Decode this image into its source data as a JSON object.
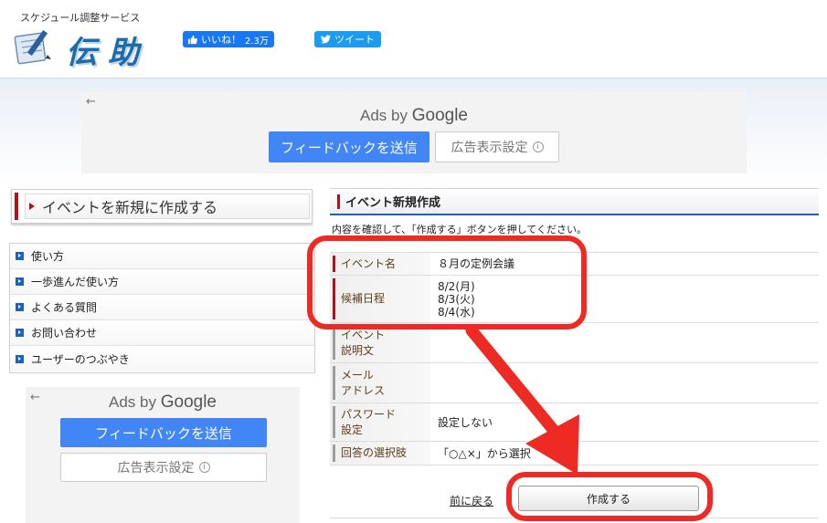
{
  "header": {
    "tagline": "スケジュール調整サービス",
    "logo_text": "伝助",
    "facebook": {
      "label": "いいね！",
      "count": "2.3万"
    },
    "twitter": {
      "label": "ツイート"
    }
  },
  "ads": {
    "back": "←",
    "ads_by": "Ads by",
    "google": "Google",
    "feedback": "フィードバックを送信",
    "settings": "広告表示設定",
    "info": "i"
  },
  "sidebar": {
    "create_event": "イベントを新規に作成する",
    "menu": [
      {
        "label": "使い方"
      },
      {
        "label": "一歩進んだ使い方"
      },
      {
        "label": "よくある質問"
      },
      {
        "label": "お問い合わせ"
      },
      {
        "label": "ユーザーのつぶやき"
      }
    ]
  },
  "main": {
    "title": "イベント新規作成",
    "instruction": "内容を確認して、「作成する」ボタンを押してください。",
    "rows": [
      {
        "label": "イベント名",
        "value": [
          "８月の定例会議"
        ]
      },
      {
        "label": "候補日程",
        "value": [
          "8/2(月)",
          "8/3(火)",
          "8/4(水)"
        ]
      },
      {
        "label": "イベント\n説明文",
        "value": []
      },
      {
        "label": "メール\nアドレス",
        "value": []
      },
      {
        "label": "パスワード\n設定",
        "value": [
          "設定しない"
        ]
      },
      {
        "label": "回答の選択肢",
        "value": [
          "「○△×」から選択"
        ]
      }
    ],
    "back_link": "前に戻る",
    "create_button": "作成する"
  },
  "colors": {
    "annotation": "#ee2a24",
    "accent_blue": "#1e63b8",
    "accent_red": "#b0121b",
    "google_blue": "#4285f4"
  }
}
